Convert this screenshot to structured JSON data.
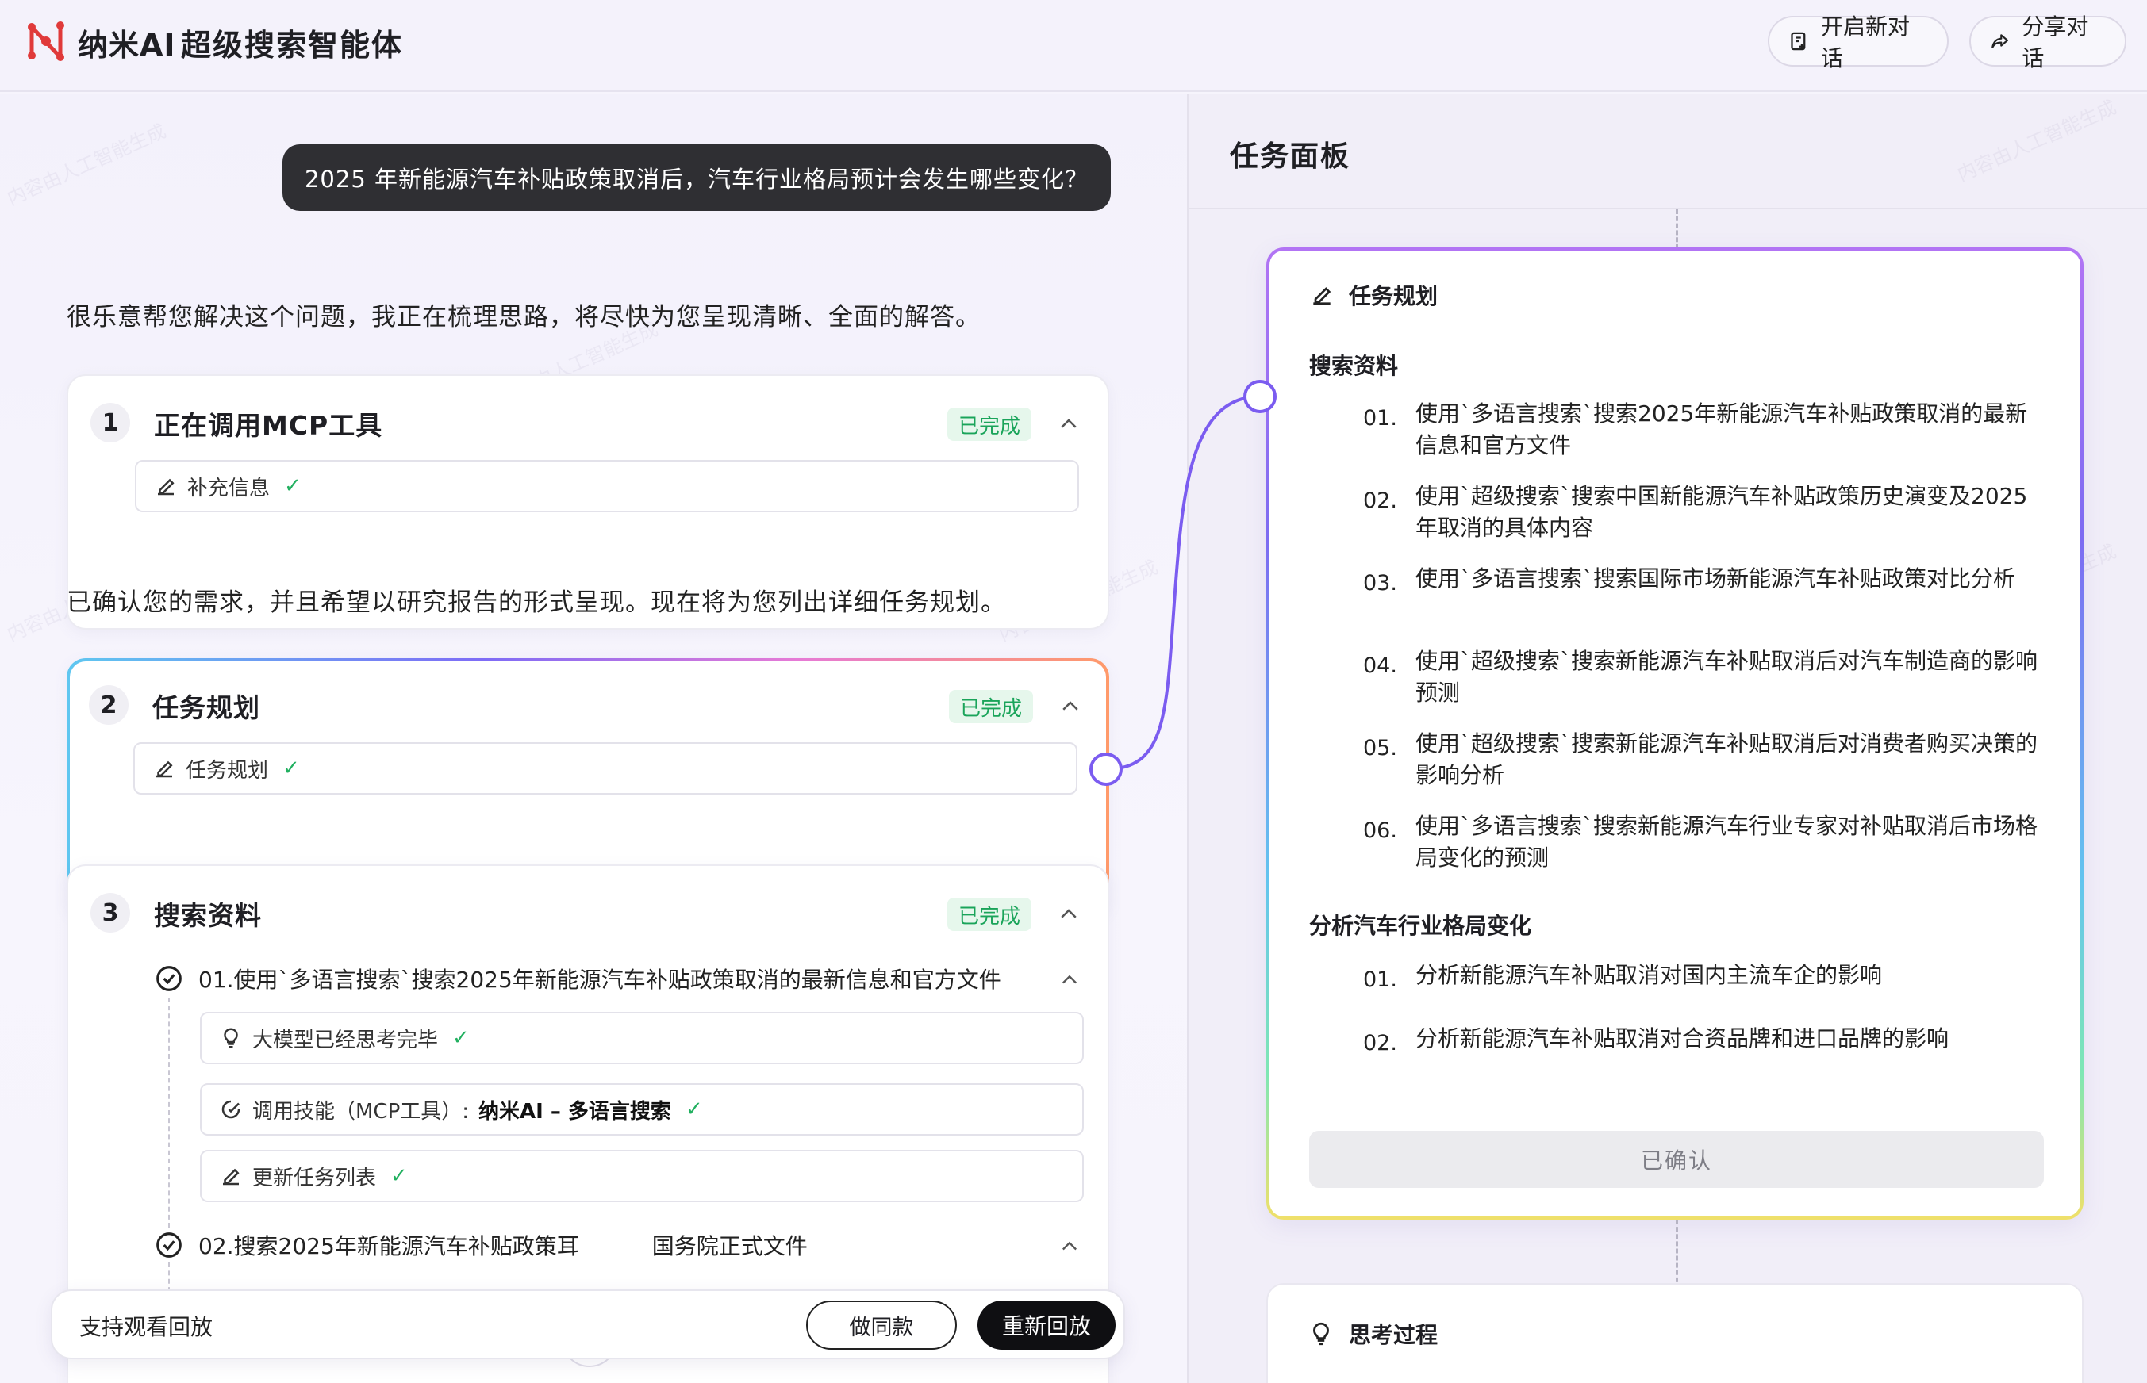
{
  "header": {
    "brand": "纳米AI",
    "product": "超级搜索智能体",
    "new_chat": "开启新对话",
    "share": "分享对话"
  },
  "chat": {
    "user_question": "2025 年新能源汽车补贴政策取消后，汽车行业格局预计会发生哪些变化？",
    "assistant_intro": "很乐意帮您解决这个问题，我正在梳理思路，将尽快为您呈现清晰、全面的解答。",
    "assistant_confirm": "已确认您的需求，并且希望以研究报告的形式呈现。现在将为您列出详细任务规划。",
    "steps": [
      {
        "num": "1",
        "title": "正在调用MCP工具",
        "status": "已完成",
        "chip": "补充信息"
      },
      {
        "num": "2",
        "title": "任务规划",
        "status": "已完成",
        "chip": "任务规划"
      },
      {
        "num": "3",
        "title": "搜索资料",
        "status": "已完成"
      }
    ],
    "search": {
      "item1": "01.使用`多语言搜索`搜索2025年新能源汽车补贴政策取消的最新信息和官方文件",
      "chip_think": "大模型已经思考完毕",
      "chip_skill_prefix": "调用技能（MCP工具）:",
      "chip_skill_name": "纳米AI – 多语言搜索",
      "chip_update": "更新任务列表",
      "item2_left": "02.搜索2025年新能源汽车补贴政策耳",
      "item2_right": "国务院正式文件"
    },
    "bottom": {
      "replay_text": "支持观看回放",
      "same_button": "做同款",
      "replay_button": "重新回放"
    }
  },
  "panel": {
    "title": "任务面板",
    "plan_title": "任务规划",
    "section1": "搜索资料",
    "items1": [
      {
        "no": "01.",
        "text": "使用`多语言搜索`搜索2025年新能源汽车补贴政策取消的最新信息和官方文件"
      },
      {
        "no": "02.",
        "text": "使用`超级搜索`搜索中国新能源汽车补贴政策历史演变及2025年取消的具体内容"
      },
      {
        "no": "03.",
        "text": "使用`多语言搜索`搜索国际市场新能源汽车补贴政策对比分析"
      },
      {
        "no": "04.",
        "text": "使用`超级搜索`搜索新能源汽车补贴取消后对汽车制造商的影响预测"
      },
      {
        "no": "05.",
        "text": "使用`超级搜索`搜索新能源汽车补贴取消后对消费者购买决策的影响分析"
      },
      {
        "no": "06.",
        "text": "使用`多语言搜索`搜索新能源汽车行业专家对补贴取消后市场格局变化的预测"
      }
    ],
    "section2": "分析汽车行业格局变化",
    "items2": [
      {
        "no": "01.",
        "text": "分析新能源汽车补贴取消对国内主流车企的影响"
      },
      {
        "no": "02.",
        "text": "分析新能源汽车补贴取消对合资品牌和进口品牌的影响"
      }
    ],
    "confirm": "已确认",
    "thinking_title": "思考过程"
  },
  "watermark": "内容由人工智能生成",
  "colors": {
    "accent": "#7b5cf0",
    "success": "#1aa45a",
    "dark": "#0f0f12"
  }
}
